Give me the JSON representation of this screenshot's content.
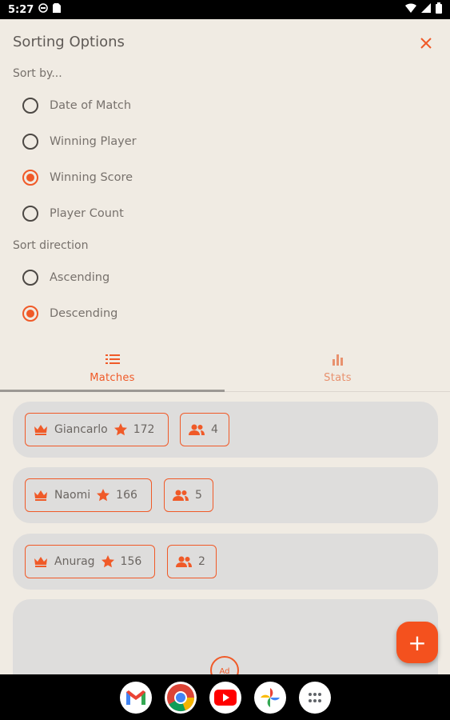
{
  "status_bar": {
    "time": "5:27",
    "left_icons": [
      "vpn-icon",
      "sim-card-icon"
    ],
    "right_icons": [
      "wifi-icon",
      "signal-icon",
      "battery-icon"
    ]
  },
  "sheet": {
    "title": "Sorting Options",
    "close_icon": "close-icon",
    "sort_by_label": "Sort by...",
    "sort_by_options": [
      {
        "label": "Date of Match",
        "checked": false
      },
      {
        "label": "Winning Player",
        "checked": false
      },
      {
        "label": "Winning Score",
        "checked": true
      },
      {
        "label": "Player Count",
        "checked": false
      }
    ],
    "direction_label": "Sort direction",
    "direction_options": [
      {
        "label": "Ascending",
        "checked": false
      },
      {
        "label": "Descending",
        "checked": true
      }
    ]
  },
  "tabs": [
    {
      "label": "Matches",
      "icon": "list-icon",
      "active": true
    },
    {
      "label": "Stats",
      "icon": "bar-chart-icon",
      "active": false
    }
  ],
  "matches": [
    {
      "winner": "Giancarlo",
      "score": "172",
      "player_count": "4"
    },
    {
      "winner": "Naomi",
      "score": "166",
      "player_count": "5"
    },
    {
      "winner": "Anurag",
      "score": "156",
      "player_count": "2"
    }
  ],
  "ad_badge": "Ad",
  "fab_label": "+",
  "dock": [
    "gmail-icon",
    "chrome-icon",
    "youtube-icon",
    "photos-icon",
    "app-drawer-icon"
  ],
  "colors": {
    "accent": "#f05a28",
    "background": "#f0ebe3",
    "card": "#dedddc"
  }
}
